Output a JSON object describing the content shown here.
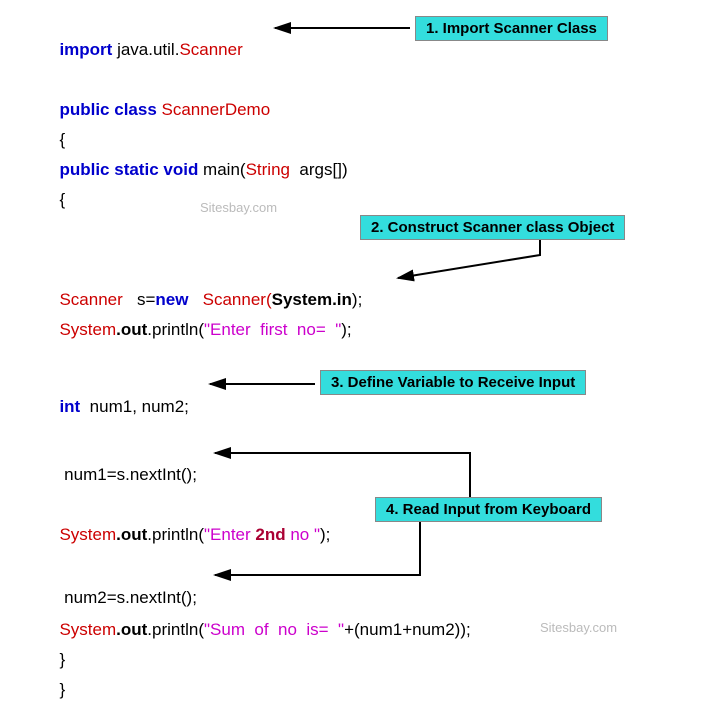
{
  "code": {
    "l1_import": "import",
    "l1_pkg": " java.util.",
    "l1_scanner": "Scanner",
    "l2_public": "public",
    "l2_class": " class",
    "l2_name": " ScannerDemo",
    "brace_open": "{",
    "l3_public": "public",
    "l3_static": " static",
    "l3_void": " void",
    "l3_main": " main(",
    "l3_string": "String",
    "l3_args": "  args[])",
    "l4_scanner1": "Scanner",
    "l4_snew": "   s=",
    "l4_new": "new",
    "l4_scanner2": "   Scanner(",
    "l4_systemin": "System.in",
    "l4_close": ");",
    "l5_system": "System",
    "l5_out": ".out",
    "l5_println": ".println(",
    "l5_str": "\"Enter  first  no=  \"",
    "l5_close": ");",
    "l6_int": "int",
    "l6_vars": "  num1, num2;",
    "l7": " num1=s.nextInt();",
    "l8_system": "System",
    "l8_out": ".out",
    "l8_println": ".println(",
    "l8_str1": "\"Enter ",
    "l8_str2": "2nd",
    "l8_str3": " no \"",
    "l8_close": ");",
    "l9": " num2=s.nextInt();",
    "l10_system": "System",
    "l10_out": ".out",
    "l10_println": ".println(",
    "l10_str": "\"Sum  of  no  is=  \"",
    "l10_plus": "+(num1+num2));",
    "brace_close": "}"
  },
  "callouts": {
    "c1": "1. Import Scanner Class",
    "c2": "2. Construct Scanner class Object",
    "c3": "3. Define Variable to Receive Input",
    "c4": "4. Read Input from Keyboard"
  },
  "watermark": "Sitesbay.com"
}
